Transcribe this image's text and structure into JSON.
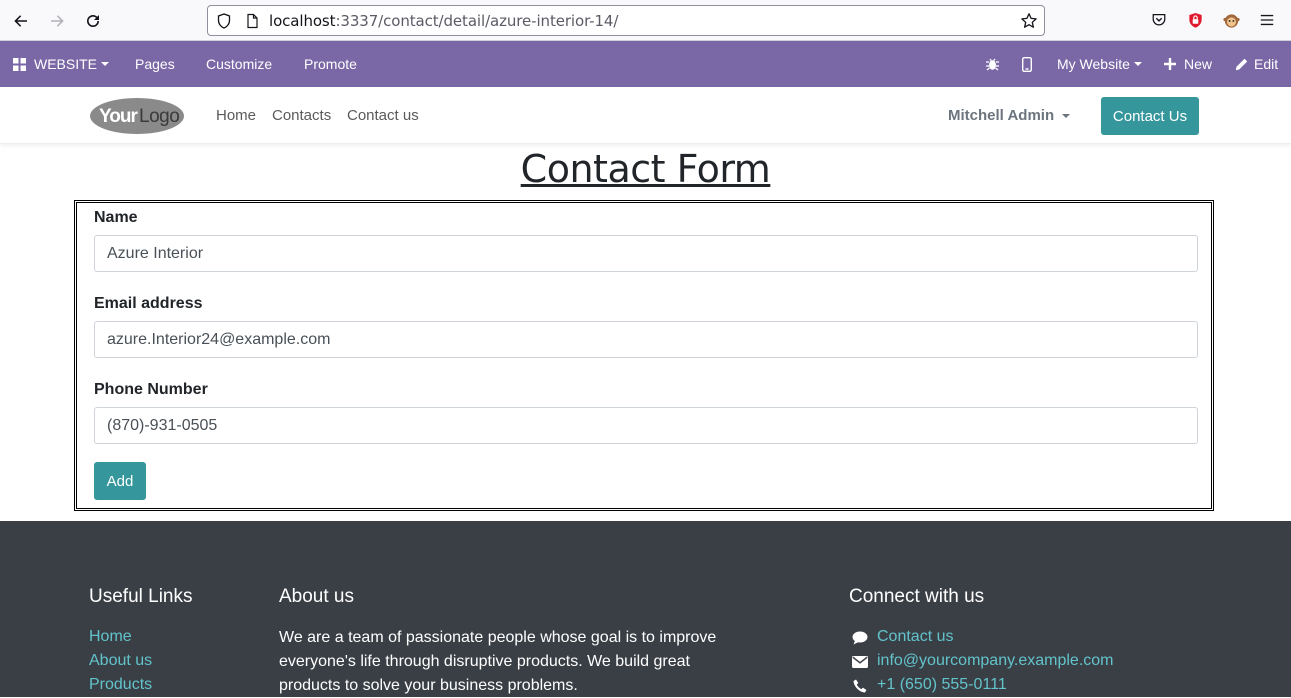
{
  "browser": {
    "url_host": "localhost",
    "url_rest": ":3337/contact/detail/azure-interior-14/"
  },
  "admin_bar": {
    "app_menu": "WEBSITE",
    "pages": "Pages",
    "customize": "Customize",
    "promote": "Promote",
    "website_selector": "My Website",
    "new": "New",
    "edit": "Edit"
  },
  "header": {
    "logo_text": "YourLogo",
    "nav": [
      "Home",
      "Contacts",
      "Contact us"
    ],
    "user": "Mitchell Admin",
    "cta": "Contact Us"
  },
  "main": {
    "title": "Contact Form",
    "fields": [
      {
        "label": "Name",
        "value": "Azure Interior"
      },
      {
        "label": "Email address",
        "value": "azure.Interior24@example.com"
      },
      {
        "label": "Phone Number",
        "value": "(870)-931-0505"
      }
    ],
    "submit": "Add"
  },
  "footer": {
    "useful_links_title": "Useful Links",
    "useful_links": [
      "Home",
      "About us",
      "Products"
    ],
    "about_title": "About us",
    "about_text": "We are a team of passionate people whose goal is to improve everyone's life through disruptive products. We build great products to solve your business problems.",
    "connect_title": "Connect with us",
    "connect": [
      {
        "icon": "comment-icon",
        "text": "Contact us"
      },
      {
        "icon": "envelope-icon",
        "text": "info@yourcompany.example.com"
      },
      {
        "icon": "phone-icon",
        "text": "+1 (650) 555-0111"
      }
    ]
  },
  "colors": {
    "admin_bar": "#7a67a6",
    "primary": "#35979c",
    "footer_bg": "#3a3f45",
    "footer_link": "#62c3cb"
  }
}
